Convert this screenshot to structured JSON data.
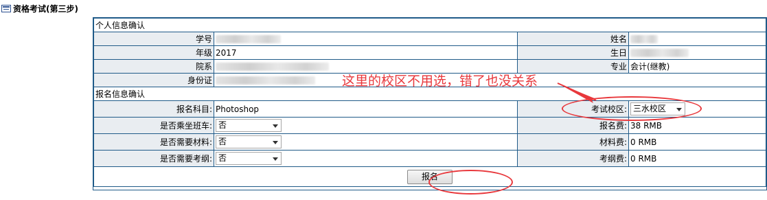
{
  "page": {
    "title": "资格考试(第三步)"
  },
  "personal": {
    "section_title": "个人信息确认",
    "student_id_label": "学号",
    "name_label": "姓名",
    "grade_label": "年级",
    "grade_value": "2017",
    "birth_label": "生日",
    "college_label": "院系",
    "major_label": "专业",
    "major_value": "会计(继教)",
    "id_card_label": "身份证"
  },
  "registration": {
    "section_title": "报名信息确认",
    "subject_label": "报名科目:",
    "subject_value": "Photoshop",
    "campus_label": "考试校区:",
    "campus_value": "三水校区",
    "shuttle_label": "是否乘坐班车:",
    "shuttle_value": "否",
    "fee_label": "报名费:",
    "fee_value": "38 RMB",
    "material_label": "是否需要材料:",
    "material_value": "否",
    "material_fee_label": "材料费:",
    "material_fee_value": "0 RMB",
    "outline_label": "是否需要考纲:",
    "outline_value": "否",
    "outline_fee_label": "考纲费:",
    "outline_fee_value": "0 RMB",
    "submit_label": "报名"
  },
  "annotation": {
    "text": "这里的校区不用选，错了也没关系",
    "color": "#e8383c"
  }
}
